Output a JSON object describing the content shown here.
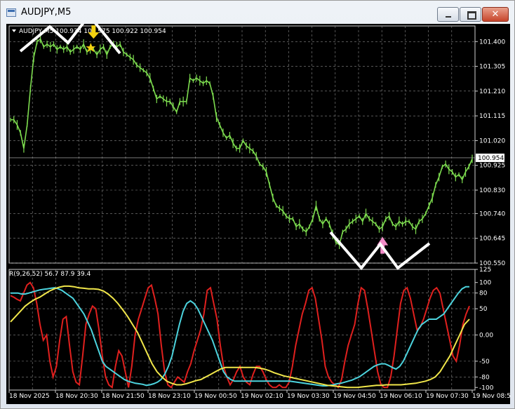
{
  "window": {
    "title": "AUDJPY,M5",
    "close_glyph": "✕"
  },
  "colors": {
    "price": "#7ddc4f",
    "red": "#e0201e",
    "cyan": "#4cd3dd",
    "yellow": "#f0e64a",
    "grid": "#8a8a8a",
    "pink": "#f28cc8",
    "gold": "#f3d110"
  },
  "chart_data": [
    {
      "type": "line",
      "title": "AUDJPY,M5",
      "header_text": "AUDJPY,M5  100.934 100.975 100.922 100.954",
      "ylim": [
        100.55,
        101.46
      ],
      "yticks": [
        "101.400",
        "101.305",
        "101.210",
        "101.115",
        "101.020",
        "100.925",
        "100.830",
        "100.740",
        "100.645",
        "100.550"
      ],
      "current_price": "100.954",
      "xticks": [
        "18 Nov 2025",
        "18 Nov 20:30",
        "18 Nov 21:50",
        "18 Nov 23:10",
        "19 Nov 00:50",
        "19 Nov 02:10",
        "19 Nov 03:30",
        "19 Nov 04:50",
        "19 Nov 06:10",
        "19 Nov 07:30",
        "19 Nov 08:50"
      ],
      "series": [
        {
          "values": [
            101.1,
            101.1,
            101.08,
            101.05,
            100.99,
            101.08,
            101.22,
            101.34,
            101.4,
            101.41,
            101.38,
            101.39,
            101.38,
            101.39,
            101.37,
            101.38,
            101.37,
            101.38,
            101.36,
            101.37,
            101.38,
            101.37,
            101.39,
            101.36,
            101.37,
            101.37,
            101.35,
            101.37,
            101.38,
            101.35,
            101.38,
            101.39,
            101.38,
            101.39,
            101.36,
            101.35,
            101.34,
            101.33,
            101.31,
            101.3,
            101.29,
            101.28,
            101.26,
            101.22,
            101.18,
            101.19,
            101.18,
            101.17,
            101.17,
            101.15,
            101.13,
            101.17,
            101.17,
            101.17,
            101.26,
            101.25,
            101.26,
            101.25,
            101.24,
            101.25,
            101.24,
            101.19,
            101.11,
            101.08,
            101.05,
            101.03,
            101.04,
            101.01,
            100.99,
            100.99,
            101.02,
            101.0,
            100.99,
            100.98,
            100.96,
            100.93,
            100.92,
            100.9,
            100.85,
            100.8,
            100.77,
            100.76,
            100.75,
            100.73,
            100.72,
            100.72,
            100.69,
            100.7,
            100.68,
            100.67,
            100.69,
            100.72,
            100.77,
            100.72,
            100.7,
            100.72,
            100.7,
            100.66,
            100.63,
            100.62,
            100.67,
            100.68,
            100.7,
            100.71,
            100.72,
            100.73,
            100.71,
            100.74,
            100.72,
            100.71,
            100.7,
            100.68,
            100.69,
            100.72,
            100.73,
            100.7,
            100.69,
            100.71,
            100.7,
            100.71,
            100.71,
            100.69,
            100.68,
            100.71,
            100.72,
            100.74,
            100.77,
            100.8,
            100.85,
            100.88,
            100.92,
            100.93,
            100.91,
            100.9,
            100.88,
            100.89,
            100.87,
            100.9,
            100.92,
            100.95
          ]
        }
      ],
      "annotations": [
        {
          "type": "sell-arrow",
          "x_index": 25,
          "value": 101.43
        },
        {
          "type": "buy-arrow",
          "x_index": 112,
          "value": 100.64
        }
      ]
    },
    {
      "type": "line",
      "title": "R(9,26,52) 56.7 87.9 39.4",
      "ylim": [
        -105,
        125
      ],
      "yticks": [
        "125",
        "100",
        "80",
        "50",
        "0.00",
        "-50",
        "-80",
        "-100"
      ],
      "series": [
        {
          "name": "",
          "color_key": "red",
          "values": [
            75,
            72,
            68,
            65,
            80,
            95,
            100,
            90,
            60,
            20,
            -10,
            0,
            -50,
            -80,
            -60,
            -10,
            30,
            35,
            -20,
            -70,
            -90,
            -95,
            -40,
            20,
            40,
            55,
            50,
            10,
            -40,
            -80,
            -95,
            -100,
            -60,
            -30,
            -40,
            -70,
            -100,
            -60,
            0,
            30,
            50,
            70,
            90,
            95,
            70,
            40,
            -20,
            -70,
            -95,
            -100,
            -90,
            -80,
            -85,
            -90,
            -70,
            -55,
            -30,
            -10,
            10,
            40,
            85,
            90,
            60,
            30,
            -20,
            -60,
            -80,
            -95,
            -85,
            -70,
            -60,
            -80,
            -90,
            -95,
            -75,
            -60,
            -60,
            -70,
            -85,
            -95,
            -100,
            -100,
            -95,
            -100,
            -100,
            -90,
            -60,
            -20,
            10,
            40,
            60,
            85,
            90,
            70,
            30,
            -10,
            -60,
            -80,
            -90,
            -95,
            -100,
            -85,
            -50,
            -20,
            0,
            20,
            60,
            90,
            85,
            50,
            10,
            -30,
            -70,
            -95,
            -100,
            -100,
            -80,
            -40,
            10,
            60,
            85,
            90,
            70,
            40,
            10,
            15,
            30,
            50,
            70,
            85,
            90,
            80,
            50,
            20,
            -10,
            -40,
            -50,
            -20,
            20,
            40,
            55
          ]
        },
        {
          "name": "",
          "color_key": "cyan",
          "values": [
            80,
            80,
            80,
            78,
            78,
            80,
            82,
            84,
            86,
            87,
            88,
            89,
            90,
            88,
            85,
            80,
            75,
            70,
            60,
            50,
            40,
            25,
            10,
            -10,
            -30,
            -50,
            -60,
            -65,
            -70,
            -75,
            -80,
            -85,
            -88,
            -90,
            -92,
            -93,
            -94,
            -96,
            -95,
            -93,
            -90,
            -85,
            -75,
            -60,
            -40,
            -10,
            20,
            45,
            60,
            65,
            60,
            50,
            35,
            20,
            5,
            -10,
            -30,
            -50,
            -70,
            -80,
            -85,
            -88,
            -88,
            -88,
            -88,
            -88,
            -88,
            -88,
            -88,
            -88,
            -88,
            -88,
            -88,
            -88,
            -88,
            -88,
            -88,
            -89,
            -90,
            -91,
            -92,
            -93,
            -94,
            -95,
            -96,
            -97,
            -97,
            -96,
            -95,
            -93,
            -92,
            -90,
            -88,
            -86,
            -83,
            -80,
            -75,
            -70,
            -65,
            -60,
            -57,
            -55,
            -55,
            -58,
            -62,
            -65,
            -60,
            -50,
            -35,
            -20,
            -5,
            10,
            20,
            25,
            30,
            30,
            30,
            35,
            40,
            50,
            60,
            70,
            80,
            88,
            92,
            92
          ]
        },
        {
          "name": "",
          "color_key": "yellow",
          "values": [
            25,
            35,
            45,
            55,
            62,
            68,
            72,
            78,
            84,
            88,
            91,
            93,
            93,
            92,
            90,
            89,
            88,
            88,
            87,
            84,
            78,
            70,
            60,
            48,
            35,
            20,
            5,
            -15,
            -35,
            -55,
            -70,
            -80,
            -88,
            -92,
            -95,
            -95,
            -93,
            -90,
            -87,
            -85,
            -80,
            -75,
            -70,
            -65,
            -62,
            -62,
            -62,
            -62,
            -62,
            -62,
            -62,
            -63,
            -65,
            -68,
            -72,
            -75,
            -78,
            -80,
            -82,
            -84,
            -86,
            -88,
            -90,
            -92,
            -94,
            -96,
            -97,
            -98,
            -99,
            -100,
            -100,
            -100,
            -99,
            -98,
            -97,
            -96,
            -96,
            -95,
            -95,
            -95,
            -95,
            -94,
            -93,
            -92,
            -90,
            -88,
            -85,
            -80,
            -70,
            -55,
            -40,
            -20,
            0,
            20,
            30
          ]
        }
      ]
    }
  ]
}
